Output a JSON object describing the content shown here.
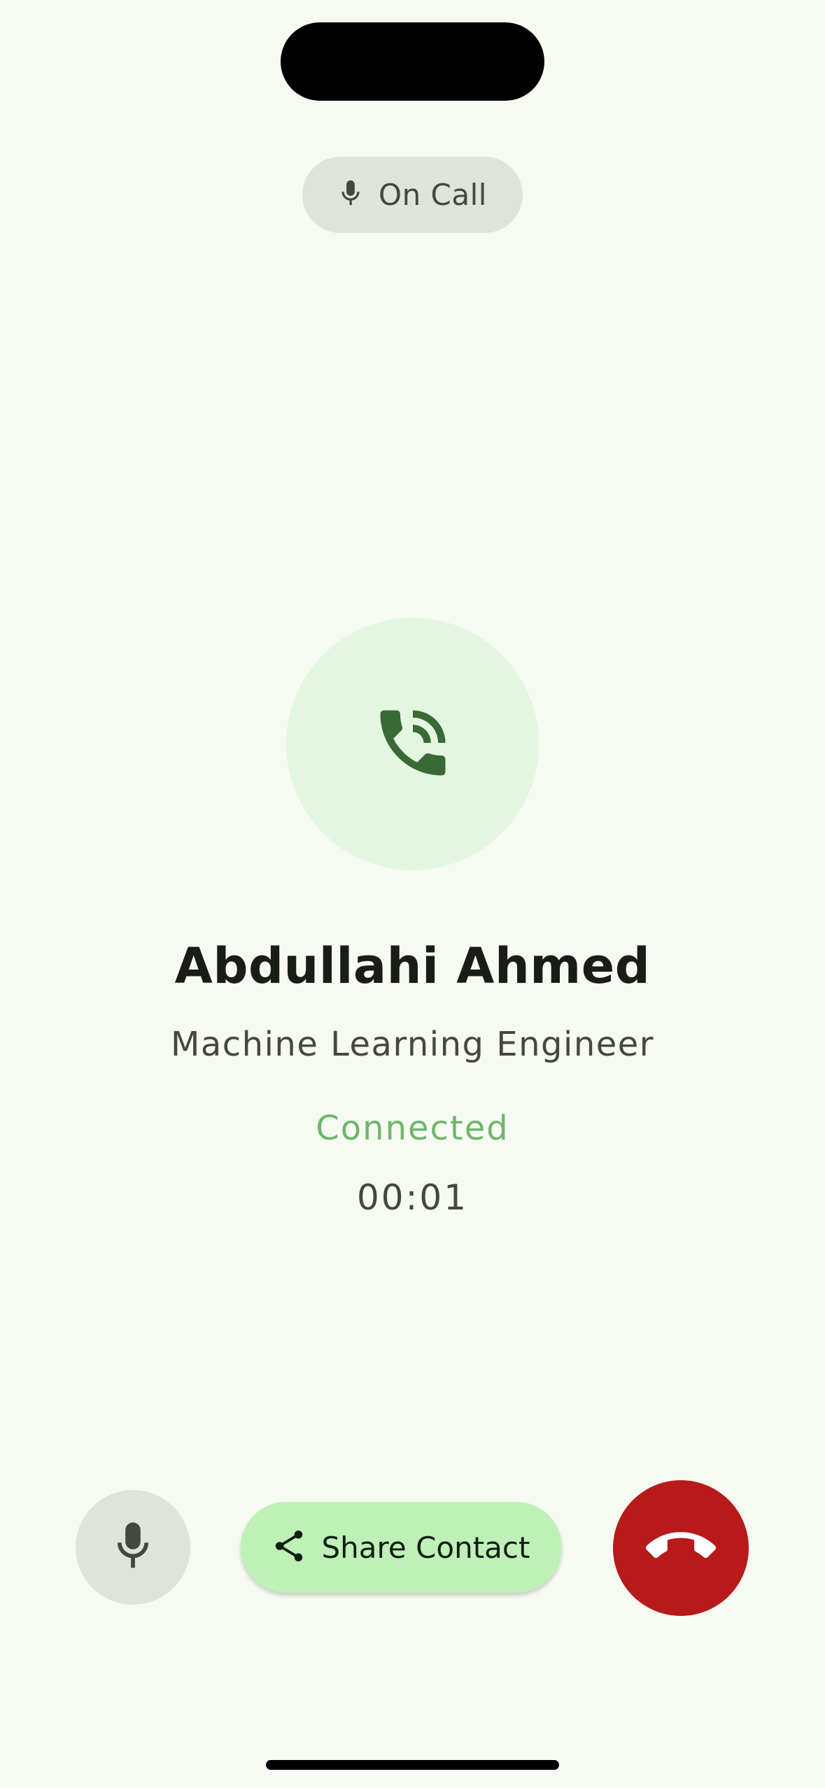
{
  "status_chip": {
    "label": "On Call",
    "icon": "mic-icon"
  },
  "contact": {
    "name": "Abdullahi Ahmed",
    "title": "Machine Learning Engineer",
    "avatar_icon": "phone-in-talk-icon"
  },
  "call": {
    "state": "Connected",
    "timer": "00:01"
  },
  "controls": {
    "mute_icon": "mic-icon",
    "share_label": "Share Contact",
    "share_icon": "share-icon",
    "end_icon": "call-end-icon"
  },
  "colors": {
    "background": "#f7faf2",
    "connected": "#6bb86b",
    "end_call": "#b8191b",
    "share_button": "#bff0b8",
    "avatar_bg": "#e3f6df",
    "avatar_icon": "#386a35"
  }
}
